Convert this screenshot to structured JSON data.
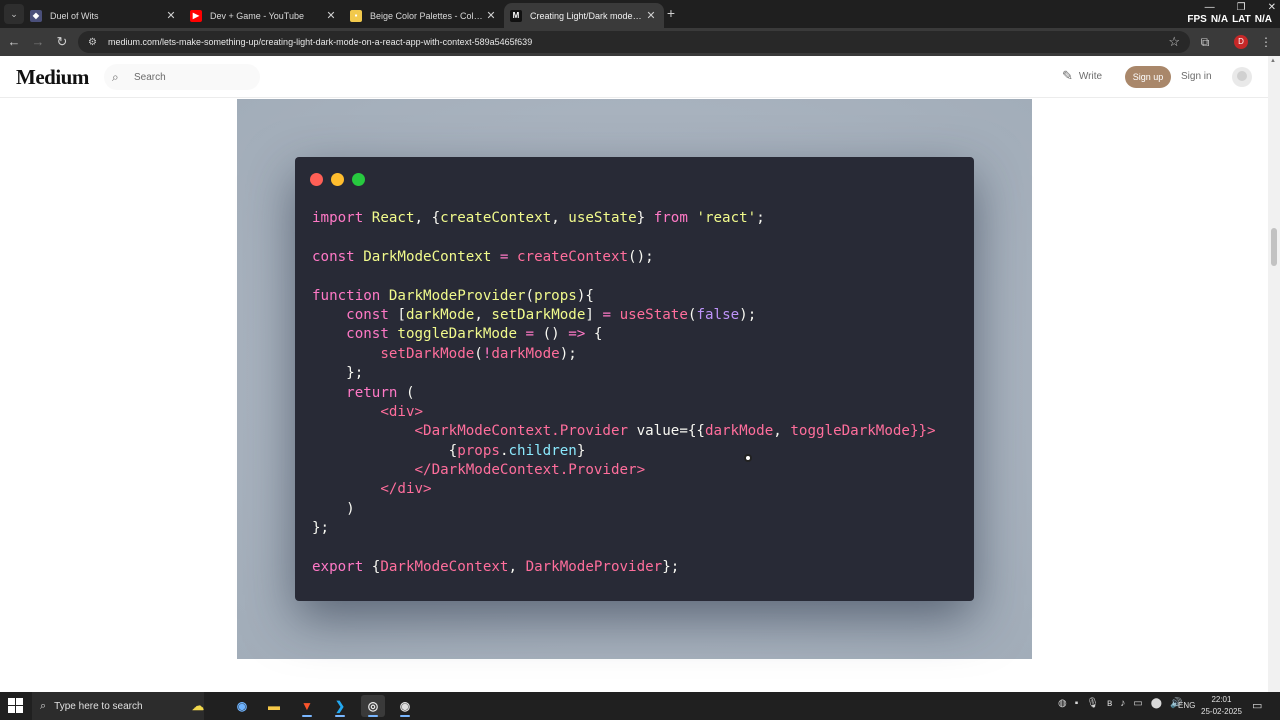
{
  "browser": {
    "tabs": [
      {
        "title": "Duel of Wits",
        "fav_color": "#4a4f7a",
        "fav_glyph": "◆",
        "close": "✕",
        "active": false
      },
      {
        "title": "Dev + Game - YouTube",
        "fav_color": "#ff0000",
        "fav_glyph": "▶",
        "close": "✕",
        "active": false
      },
      {
        "title": "Beige Color Palettes - Color Hu",
        "fav_color": "#f2c94c",
        "fav_glyph": "▪",
        "close": "✕",
        "active": false
      },
      {
        "title": "Creating Light/Dark mode on a",
        "fav_color": "#111111",
        "fav_glyph": "M",
        "close": "✕",
        "active": true
      }
    ],
    "new_tab": "+",
    "fps": [
      "FPS",
      "N/A",
      "LAT",
      "N/A"
    ],
    "window_controls": [
      "—",
      "❐",
      "✕"
    ],
    "url": "medium.com/lets-make-something-up/creating-light-dark-mode-on-a-react-app-with-context-589a5465f639",
    "profile_initial": "D"
  },
  "medium": {
    "logo": "Medium",
    "search_placeholder": "Search",
    "write_label": "Write",
    "signup_label": "Sign up",
    "signin_label": "Sign in",
    "accent": "#a9876a"
  },
  "code_window": {
    "dots": [
      "#ff5f56",
      "#ffbd2e",
      "#27c93f"
    ],
    "lines": [
      [
        [
          "import ",
          "#ff79c6"
        ],
        [
          "React",
          "#f1fa8c"
        ],
        [
          ", {",
          "#f8f8f2"
        ],
        [
          "createContext",
          "#f1fa8c"
        ],
        [
          ", ",
          "#f8f8f2"
        ],
        [
          "useState",
          "#f1fa8c"
        ],
        [
          "} ",
          "#f8f8f2"
        ],
        [
          "from ",
          "#ff79c6"
        ],
        [
          "'react'",
          "#f1fa8c"
        ],
        [
          ";",
          "#f8f8f2"
        ]
      ],
      [],
      [
        [
          "const ",
          "#ff79c6"
        ],
        [
          "DarkModeContext",
          "#f1fa8c"
        ],
        [
          " = ",
          "#ff79c6"
        ],
        [
          "createContext",
          "#ff6e9c"
        ],
        [
          "();",
          "#f8f8f2"
        ]
      ],
      [],
      [
        [
          "function ",
          "#ff79c6"
        ],
        [
          "DarkModeProvider",
          "#f1fa8c"
        ],
        [
          "(",
          "#f8f8f2"
        ],
        [
          "props",
          "#f1fa8c"
        ],
        [
          "){",
          "#f8f8f2"
        ]
      ],
      [
        [
          "    const ",
          "#ff79c6"
        ],
        [
          "[",
          "#f8f8f2"
        ],
        [
          "darkMode",
          "#f1fa8c"
        ],
        [
          ", ",
          "#f8f8f2"
        ],
        [
          "setDarkMode",
          "#f1fa8c"
        ],
        [
          "] ",
          "#f8f8f2"
        ],
        [
          "= ",
          "#ff79c6"
        ],
        [
          "useState",
          "#ff6e9c"
        ],
        [
          "(",
          "#f8f8f2"
        ],
        [
          "false",
          "#bd93f9"
        ],
        [
          ");",
          "#f8f8f2"
        ]
      ],
      [
        [
          "    const ",
          "#ff79c6"
        ],
        [
          "toggleDarkMode",
          "#f1fa8c"
        ],
        [
          " = ",
          "#ff79c6"
        ],
        [
          "() ",
          "#f8f8f2"
        ],
        [
          "=> ",
          "#ff79c6"
        ],
        [
          "{",
          "#f8f8f2"
        ]
      ],
      [
        [
          "        setDarkMode",
          "#ff6e9c"
        ],
        [
          "(",
          "#f8f8f2"
        ],
        [
          "!",
          "#ff79c6"
        ],
        [
          "darkMode",
          "#ff6e9c"
        ],
        [
          ");",
          "#f8f8f2"
        ]
      ],
      [
        [
          "    };",
          "#f8f8f2"
        ]
      ],
      [
        [
          "    return ",
          "#ff79c6"
        ],
        [
          "(",
          "#f8f8f2"
        ]
      ],
      [
        [
          "        <div>",
          "#ff6e9c"
        ]
      ],
      [
        [
          "            <DarkModeContext.Provider ",
          "#ff6e9c"
        ],
        [
          "value",
          "#f8f8f2"
        ],
        [
          "={{",
          "#f8f8f2"
        ],
        [
          "darkMode",
          "#ff6e9c"
        ],
        [
          ", ",
          "#f8f8f2"
        ],
        [
          "toggleDarkMode",
          "#ff6e9c"
        ],
        [
          "}}>",
          "#ff6e9c"
        ]
      ],
      [
        [
          "                {",
          "#f8f8f2"
        ],
        [
          "props",
          "#ff6e9c"
        ],
        [
          ".",
          "#f8f8f2"
        ],
        [
          "children",
          "#8be9fd"
        ],
        [
          "}",
          "#f8f8f2"
        ]
      ],
      [
        [
          "            </DarkModeContext.Provider>",
          "#ff6e9c"
        ]
      ],
      [
        [
          "        </div>",
          "#ff6e9c"
        ]
      ],
      [
        [
          "    )",
          "#f8f8f2"
        ]
      ],
      [
        [
          "};",
          "#f8f8f2"
        ]
      ],
      [],
      [
        [
          "export ",
          "#ff79c6"
        ],
        [
          "{",
          "#f8f8f2"
        ],
        [
          "DarkModeContext",
          "#ff6e9c"
        ],
        [
          ", ",
          "#f8f8f2"
        ],
        [
          "DarkModeProvider",
          "#ff6e9c"
        ],
        [
          "};",
          "#f8f8f2"
        ]
      ]
    ]
  },
  "taskbar": {
    "search_placeholder": "Type here to search",
    "apps": [
      {
        "name": "widgets",
        "glyph": "☁",
        "color": "#f2d94c"
      },
      {
        "name": "copilot",
        "glyph": "◉",
        "color": "#6fb4ff"
      },
      {
        "name": "file-explorer",
        "glyph": "▬",
        "color": "#f7c948"
      },
      {
        "name": "brave",
        "glyph": "▼",
        "color": "#fb542b"
      },
      {
        "name": "vscode",
        "glyph": "❯",
        "color": "#23a9f2"
      },
      {
        "name": "chrome",
        "glyph": "◎",
        "color": "#e8e8e8"
      },
      {
        "name": "obs",
        "glyph": "◉",
        "color": "#e0e0e0"
      }
    ],
    "tray_icons": [
      "◍",
      "▪",
      "🎙",
      "ʙ",
      "♪",
      "▭",
      "⬤",
      "🔊"
    ],
    "language": "ENG",
    "time": "22:01",
    "date": "25-02-2025",
    "notification_icon": "▭"
  }
}
